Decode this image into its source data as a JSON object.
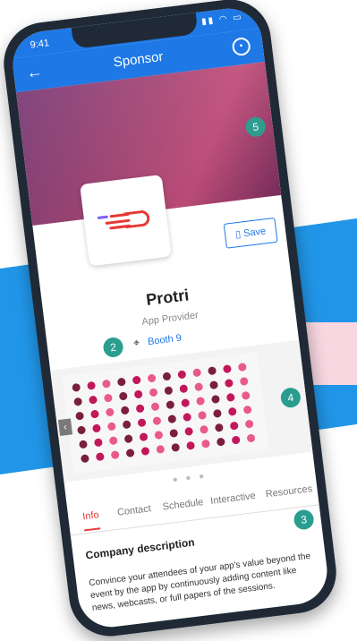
{
  "status": {
    "time": "9:41"
  },
  "header": {
    "title": "Sponsor",
    "back_icon": "arrow-left-icon",
    "profile_icon": "user-circle-icon"
  },
  "hero": {
    "badge": "5"
  },
  "company": {
    "save_label": "Save",
    "name": "Protri",
    "role": "App Provider",
    "booth_label": "Booth 9",
    "badge_left": "2",
    "badge_right": "4"
  },
  "tabs": [
    {
      "label": "Info"
    },
    {
      "label": "Contact"
    },
    {
      "label": "Schedule"
    },
    {
      "label": "Interactive"
    },
    {
      "label": "Resources"
    }
  ],
  "description": {
    "title": "Company description",
    "badge": "3",
    "text": "Convince your attendees of your app's value beyond the event by the app by continuously adding content like news, webcasts, or full papers of the sessions."
  },
  "colors": {
    "primary": "#1e78e6",
    "accent": "#e53935",
    "badge": "#2a9d8f"
  }
}
